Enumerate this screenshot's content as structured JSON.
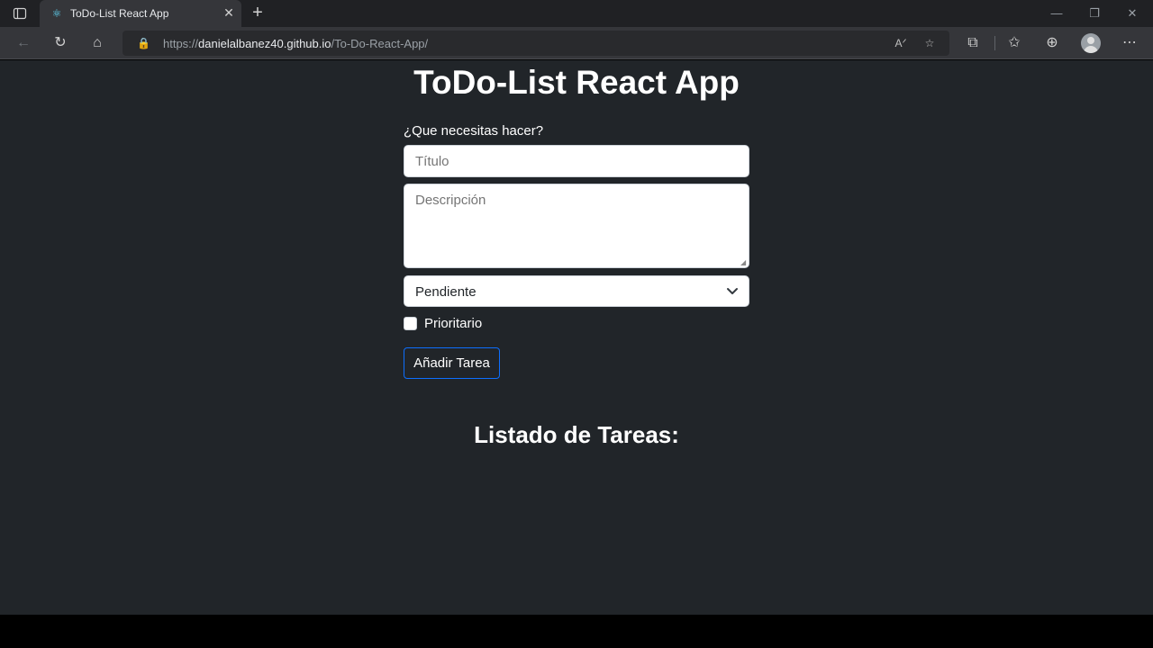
{
  "browser": {
    "tab_title": "ToDo-List React App",
    "address_scheme": "https://",
    "address_host": "danielalbanez40.github.io",
    "address_path": "/To-Do-React-App/",
    "icons": {
      "tab_actions": "tab-actions-icon",
      "favicon": "react-icon",
      "tab_close": "close-icon",
      "new_tab": "plus-icon",
      "back": "back-arrow-icon",
      "refresh": "refresh-icon",
      "home": "home-icon",
      "lock": "lock-icon",
      "read_aloud": "read-aloud-icon",
      "add_favorite": "add-favorite-icon",
      "extensions": "extensions-icon",
      "favorites": "favorites-icon",
      "collections": "collections-icon",
      "profile": "profile-icon",
      "more": "more-icon",
      "minimize": "minimize-icon",
      "restore": "restore-icon",
      "window_close": "window-close-icon"
    }
  },
  "app": {
    "heading": "ToDo-List React App",
    "form": {
      "label": "¿Que necesitas hacer?",
      "title_placeholder": "Título",
      "title_value": "",
      "description_placeholder": "Descripción",
      "description_value": "",
      "status_selected": "Pendiente",
      "priority_label": "Prioritario",
      "priority_checked": false,
      "submit_label": "Añadir Tarea"
    },
    "list_heading": "Listado de Tareas:"
  },
  "colors": {
    "page_bg": "#212529",
    "button_border": "#0d6efd",
    "chrome_bg": "#35363a",
    "tabbar_bg": "#202124"
  }
}
